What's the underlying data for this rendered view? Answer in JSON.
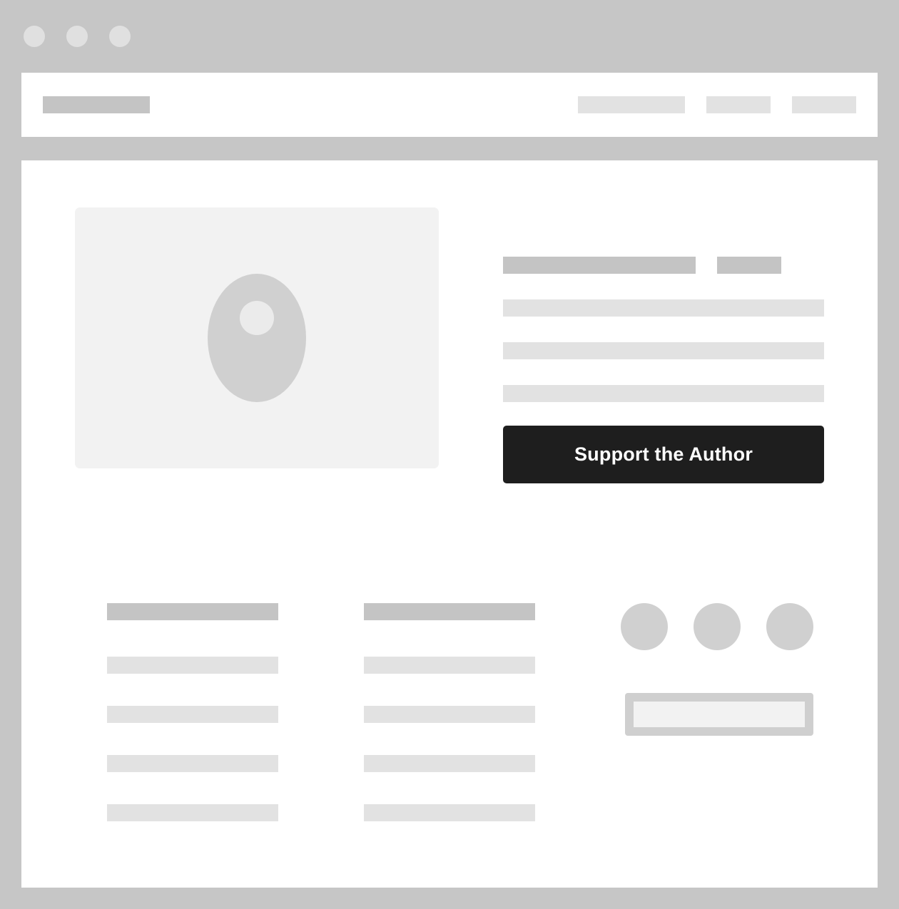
{
  "colors": {
    "frame": "#c6c6c6",
    "dot": "#e0e0e0",
    "white": "#ffffff",
    "placeholder_dark": "#c4c4c4",
    "placeholder_light": "#e2e2e2",
    "image_bg": "#f2f2f2",
    "image_shape": "#d0d0d0",
    "image_highlight": "#ebebeb",
    "button_bg": "#1e1e1e",
    "button_text": "#ffffff",
    "social": "#d0d0d0",
    "input_border": "#cfcfcf",
    "input_bg": "#f2f2f2"
  },
  "window": {
    "controls": [
      "window-dot",
      "window-dot",
      "window-dot"
    ]
  },
  "hero": {
    "image_icon": "image-placeholder-icon",
    "cta_label": "Support the Author"
  },
  "footer": {
    "social_icons": [
      "social-icon",
      "social-icon",
      "social-icon"
    ]
  }
}
